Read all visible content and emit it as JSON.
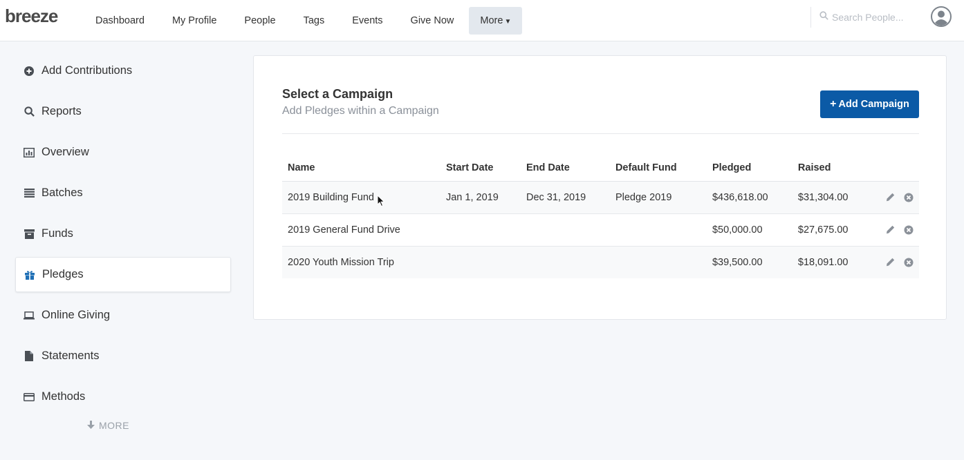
{
  "app": {
    "logo": "breeze"
  },
  "nav": {
    "items": [
      {
        "label": "Dashboard"
      },
      {
        "label": "My Profile"
      },
      {
        "label": "People"
      },
      {
        "label": "Tags"
      },
      {
        "label": "Events"
      },
      {
        "label": "Give Now"
      }
    ],
    "more_label": "More",
    "search_placeholder": "Search People..."
  },
  "sidebar": {
    "items": [
      {
        "label": "Add Contributions",
        "icon": "plus-circle-icon"
      },
      {
        "label": "Reports",
        "icon": "search-icon"
      },
      {
        "label": "Overview",
        "icon": "bar-chart-icon"
      },
      {
        "label": "Batches",
        "icon": "list-icon"
      },
      {
        "label": "Funds",
        "icon": "archive-icon"
      },
      {
        "label": "Pledges",
        "icon": "gift-icon",
        "active": true
      },
      {
        "label": "Online Giving",
        "icon": "laptop-icon"
      },
      {
        "label": "Statements",
        "icon": "file-icon"
      },
      {
        "label": "Methods",
        "icon": "credit-card-icon"
      }
    ],
    "more_label": "MORE"
  },
  "main": {
    "title": "Select a Campaign",
    "subtitle": "Add Pledges within a Campaign",
    "add_button_label": "Add Campaign",
    "table": {
      "headers": [
        "Name",
        "Start Date",
        "End Date",
        "Default Fund",
        "Pledged",
        "Raised"
      ],
      "rows": [
        {
          "name": "2019 Building Fund",
          "start": "Jan 1, 2019",
          "end": "Dec 31, 2019",
          "fund": "Pledge 2019",
          "pledged": "$436,618.00",
          "raised": "$31,304.00"
        },
        {
          "name": "2019 General Fund Drive",
          "start": "",
          "end": "",
          "fund": "",
          "pledged": "$50,000.00",
          "raised": "$27,675.00"
        },
        {
          "name": "2020 Youth Mission Trip",
          "start": "",
          "end": "",
          "fund": "",
          "pledged": "$39,500.00",
          "raised": "$18,091.00"
        }
      ]
    }
  },
  "colors": {
    "accent": "#0b5aa6",
    "active_icon": "#1f6fb5",
    "background": "#f5f7fa"
  }
}
